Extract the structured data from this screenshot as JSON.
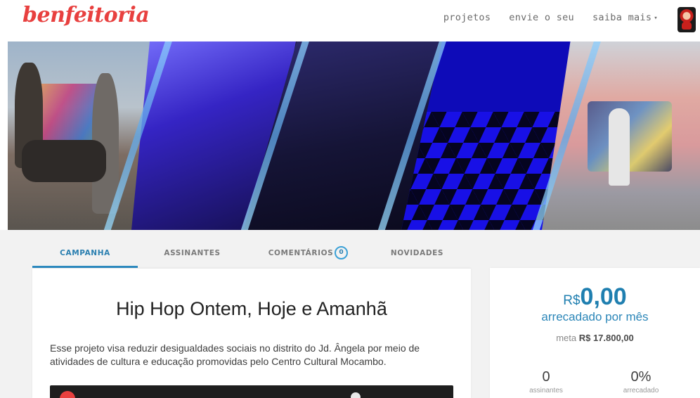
{
  "brand": {
    "logo": "benfeitoria",
    "accent": "#e8403f"
  },
  "nav": {
    "projects": "projetos",
    "submit": "envie o seu",
    "more": "saiba mais",
    "more_caret": "▾"
  },
  "tabs": [
    {
      "label": "CAMPANHA",
      "active": true
    },
    {
      "label": "ASSINANTES",
      "active": false
    },
    {
      "label": "COMENTÁRIOS",
      "badge": "0",
      "active": false
    },
    {
      "label": "NOVIDADES",
      "active": false
    }
  ],
  "project": {
    "title": "Hip Hop Ontem, Hoje e Amanhã",
    "description": "Esse projeto visa reduzir desigualdades sociais no distrito do Jd. Ângela por meio de atividades de cultura e educação promovidas pelo Centro Cultural Mocambo."
  },
  "funding": {
    "currency": "R$",
    "raised": "0,00",
    "raised_label": "arrecadado por mês",
    "goal_label": "meta",
    "goal_value": "R$ 17.800,00",
    "subscribers_count": "0",
    "subscribers_label": "assinantes",
    "percent": "0%",
    "percent_label": "arrecadado",
    "color": "#1f7fb0"
  }
}
